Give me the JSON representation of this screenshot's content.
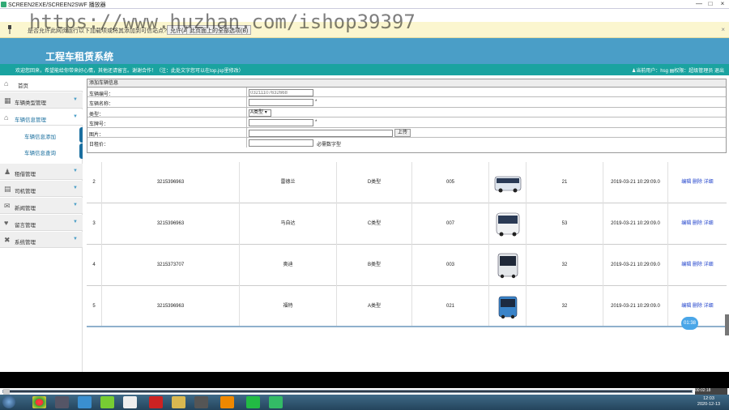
{
  "window": {
    "title": "SCREEN2EXE/SCREEN2SWF 播放器",
    "buttons": [
      "—",
      "□",
      "×"
    ]
  },
  "watermark": "https://www.huzhan.com/ishop39397",
  "ie_bar": {
    "message": "是否允许此网页运行以下加载项或将其添加到可信站点?",
    "allow_label": "允许(A)",
    "more_label": "此页面上的全部选项(B)",
    "close": "×"
  },
  "header": {
    "system_title": "工程车租赁系统",
    "welcome": "欢迎您回来，希望能给你带来好心情，其他还请留言。谢谢合作！（注：此处文字您可以在top.jsp里修改）",
    "user_label": "当前用户：hsg",
    "role_label": "权限：超级管理员",
    "logout_label": "退出"
  },
  "sidebar": {
    "items": [
      {
        "label": "首页",
        "icon": "home-icon"
      },
      {
        "label": "车辆类型管理",
        "icon": "grid-icon"
      },
      {
        "label": "车辆信息管理",
        "icon": "home-icon"
      },
      {
        "label": "租借管理",
        "icon": "user-icon"
      },
      {
        "label": "司机管理",
        "icon": "book-icon"
      },
      {
        "label": "新闻管理",
        "icon": "chat-icon"
      },
      {
        "label": "留言管理",
        "icon": "heart-icon"
      },
      {
        "label": "系统管理",
        "icon": "tools-icon"
      }
    ],
    "sub_items": [
      "车辆信息添加",
      "车辆信息查询"
    ]
  },
  "form": {
    "title": "添加车辆信息",
    "fields": [
      {
        "label": "车辆编号：",
        "value": "03211107632668",
        "required": false
      },
      {
        "label": "车辆名称：",
        "value": "",
        "required": true
      },
      {
        "label": "类型：",
        "value": "A类型",
        "required": false
      },
      {
        "label": "车牌号：",
        "value": "",
        "required": true
      },
      {
        "label": "图片：",
        "value": "",
        "required": false
      },
      {
        "label": "日租价：",
        "value": "",
        "required": false
      }
    ],
    "upload_label": "上传",
    "price_hint": "必需数字型",
    "required_mark": "*"
  },
  "table": {
    "rows": [
      {
        "no": "2",
        "code": "3215396963",
        "name": "雷德兰",
        "type": "D类型",
        "plate": "005",
        "count": "21",
        "time": "2019-03-21 10:29:09.0"
      },
      {
        "no": "3",
        "code": "3215396963",
        "name": "马自达",
        "type": "C类型",
        "plate": "007",
        "count": "53",
        "time": "2019-03-21 10:29:09.0"
      },
      {
        "no": "4",
        "code": "3215373707",
        "name": "奥迪",
        "type": "B类型",
        "plate": "003",
        "count": "32",
        "time": "2019-03-21 10:29:09.0"
      },
      {
        "no": "5",
        "code": "3215396963",
        "name": "福特",
        "type": "A类型",
        "plate": "021",
        "count": "32",
        "time": "2019-03-21 10:29:09.0"
      }
    ],
    "actions": {
      "edit": "编辑",
      "delete": "删除",
      "detail": "详细"
    }
  },
  "player": {
    "timer": "01:38",
    "timecode": "00:02:18"
  },
  "taskbar": {
    "time": "12:03",
    "date": "2020-12-13"
  }
}
